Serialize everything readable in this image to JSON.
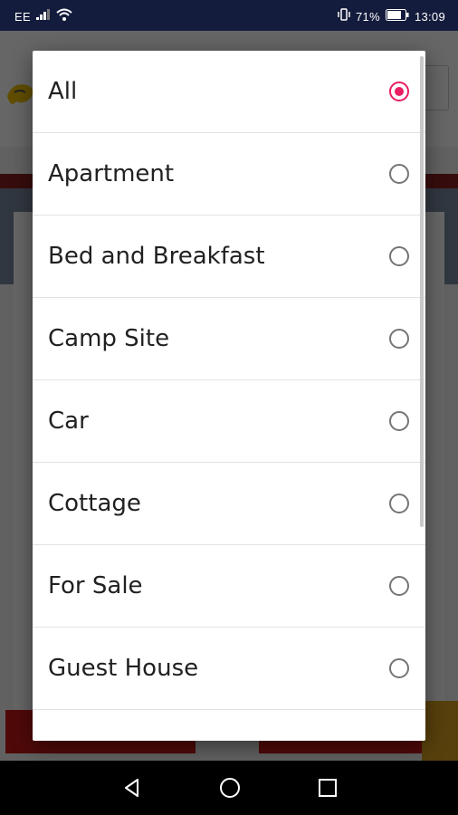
{
  "status_bar": {
    "carrier": "EE",
    "battery_percent": "71%",
    "time": "13:09",
    "icons": [
      "signal-icon",
      "wifi-icon",
      "vibrate-icon",
      "battery-icon"
    ]
  },
  "dialog": {
    "options": [
      {
        "label": "All",
        "selected": true
      },
      {
        "label": "Apartment",
        "selected": false
      },
      {
        "label": "Bed and Breakfast",
        "selected": false
      },
      {
        "label": "Camp Site",
        "selected": false
      },
      {
        "label": "Car",
        "selected": false
      },
      {
        "label": "Cottage",
        "selected": false
      },
      {
        "label": "For Sale",
        "selected": false
      },
      {
        "label": "Guest House",
        "selected": false
      }
    ]
  },
  "colors": {
    "status_bar": "#141c3d",
    "accent": "#e91e63",
    "radio_unchecked": "#757575",
    "nav_bar": "#000000"
  },
  "nav_bar": {
    "icons": [
      "back-icon",
      "home-icon",
      "recents-icon"
    ]
  }
}
